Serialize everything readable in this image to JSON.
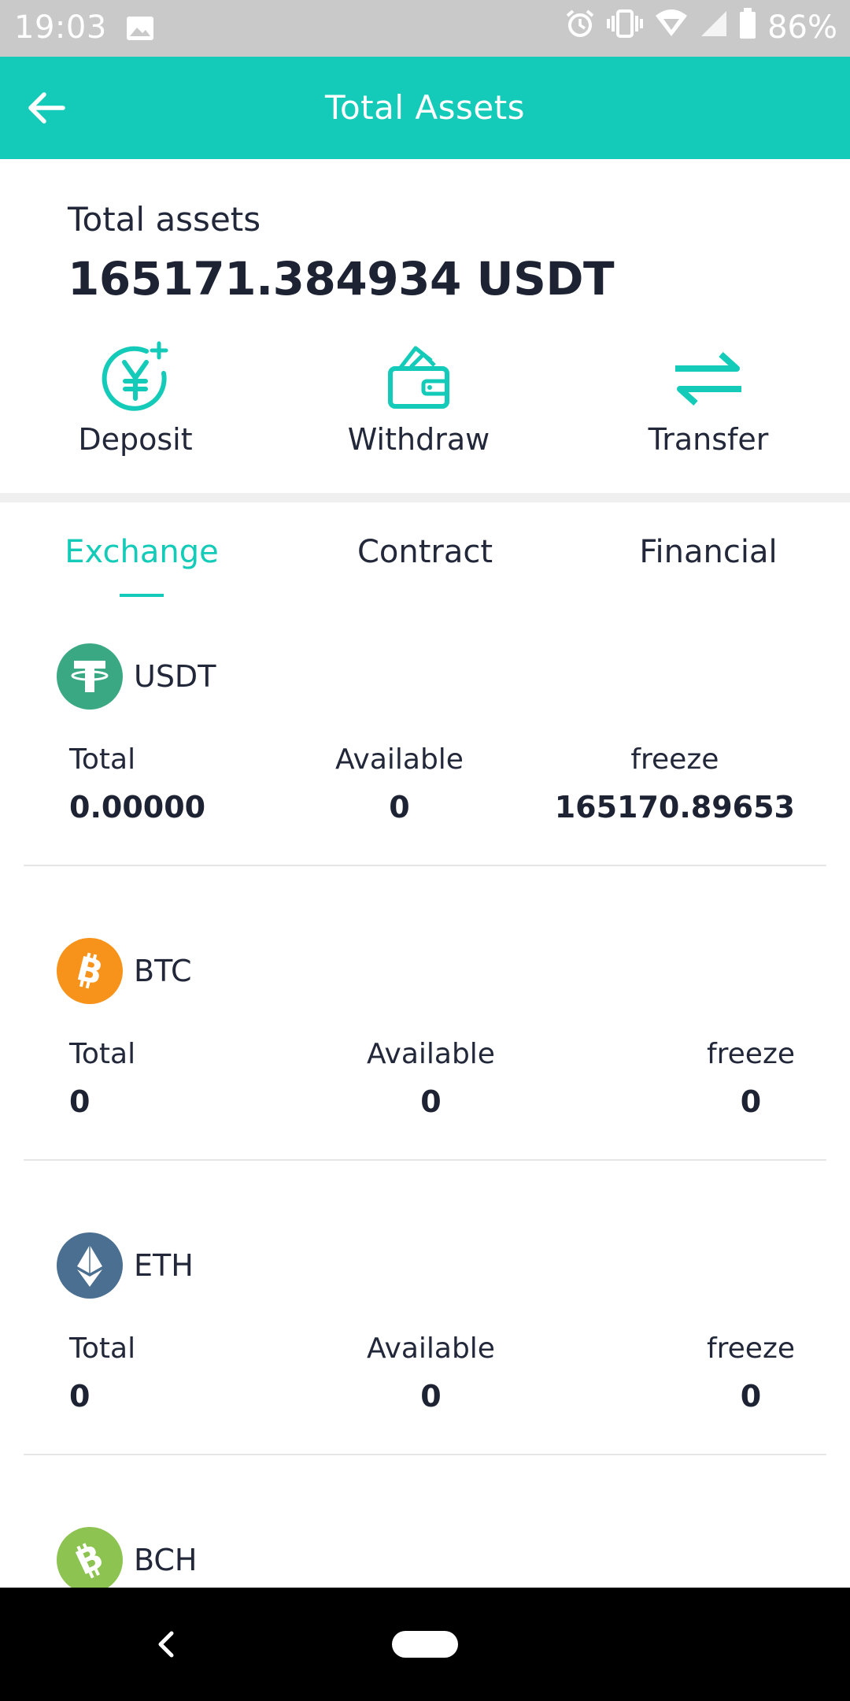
{
  "status_bar": {
    "time": "19:03",
    "battery": "86%",
    "icons": [
      "image-icon",
      "alarm-icon",
      "vibrate-icon",
      "wifi-icon",
      "signal-icon",
      "battery-icon"
    ]
  },
  "app_bar": {
    "title": "Total Assets",
    "back_icon": "arrow-left-icon"
  },
  "summary": {
    "label": "Total assets",
    "value": "165171.384934 USDT",
    "actions": [
      {
        "label": "Deposit",
        "icon": "deposit-yen-icon"
      },
      {
        "label": "Withdraw",
        "icon": "wallet-icon"
      },
      {
        "label": "Transfer",
        "icon": "transfer-arrows-icon"
      }
    ]
  },
  "tabs": [
    {
      "label": "Exchange",
      "active": true
    },
    {
      "label": "Contract",
      "active": false
    },
    {
      "label": "Financial",
      "active": false
    }
  ],
  "coins": [
    {
      "symbol": "USDT",
      "color": "#26a17b",
      "total_label": "Total",
      "total": "0.00000",
      "available_label": "Available",
      "available": "0",
      "freeze_label": "freeze",
      "freeze": "165170.89653"
    },
    {
      "symbol": "BTC",
      "color": "#f7931a",
      "total_label": "Total",
      "total": "0",
      "available_label": "Available",
      "available": "0",
      "freeze_label": "freeze",
      "freeze": "0"
    },
    {
      "symbol": "ETH",
      "color": "#4a6f91",
      "total_label": "Total",
      "total": "0",
      "available_label": "Available",
      "available": "0",
      "freeze_label": "freeze",
      "freeze": "0"
    },
    {
      "symbol": "BCH",
      "color": "#8dc351"
    }
  ],
  "colors": {
    "accent": "#13cbb8",
    "text": "#1d2333",
    "status_bar": "#c9c9c9",
    "nav_bar": "#000000"
  }
}
